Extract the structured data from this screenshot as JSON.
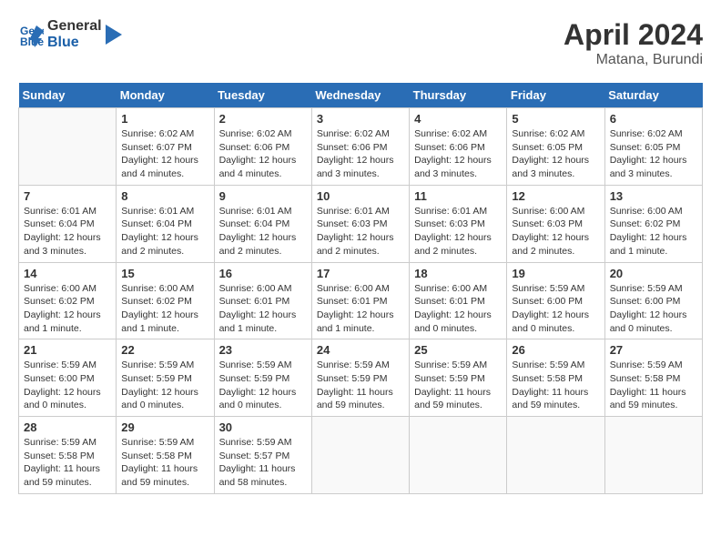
{
  "header": {
    "logo_line1": "General",
    "logo_line2": "Blue",
    "month_year": "April 2024",
    "location": "Matana, Burundi"
  },
  "weekdays": [
    "Sunday",
    "Monday",
    "Tuesday",
    "Wednesday",
    "Thursday",
    "Friday",
    "Saturday"
  ],
  "weeks": [
    [
      {
        "day": "",
        "sunrise": "",
        "sunset": "",
        "daylight": ""
      },
      {
        "day": "1",
        "sunrise": "6:02 AM",
        "sunset": "6:07 PM",
        "daylight": "12 hours and 4 minutes."
      },
      {
        "day": "2",
        "sunrise": "6:02 AM",
        "sunset": "6:06 PM",
        "daylight": "12 hours and 4 minutes."
      },
      {
        "day": "3",
        "sunrise": "6:02 AM",
        "sunset": "6:06 PM",
        "daylight": "12 hours and 3 minutes."
      },
      {
        "day": "4",
        "sunrise": "6:02 AM",
        "sunset": "6:06 PM",
        "daylight": "12 hours and 3 minutes."
      },
      {
        "day": "5",
        "sunrise": "6:02 AM",
        "sunset": "6:05 PM",
        "daylight": "12 hours and 3 minutes."
      },
      {
        "day": "6",
        "sunrise": "6:02 AM",
        "sunset": "6:05 PM",
        "daylight": "12 hours and 3 minutes."
      }
    ],
    [
      {
        "day": "7",
        "sunrise": "6:01 AM",
        "sunset": "6:04 PM",
        "daylight": "12 hours and 3 minutes."
      },
      {
        "day": "8",
        "sunrise": "6:01 AM",
        "sunset": "6:04 PM",
        "daylight": "12 hours and 2 minutes."
      },
      {
        "day": "9",
        "sunrise": "6:01 AM",
        "sunset": "6:04 PM",
        "daylight": "12 hours and 2 minutes."
      },
      {
        "day": "10",
        "sunrise": "6:01 AM",
        "sunset": "6:03 PM",
        "daylight": "12 hours and 2 minutes."
      },
      {
        "day": "11",
        "sunrise": "6:01 AM",
        "sunset": "6:03 PM",
        "daylight": "12 hours and 2 minutes."
      },
      {
        "day": "12",
        "sunrise": "6:00 AM",
        "sunset": "6:03 PM",
        "daylight": "12 hours and 2 minutes."
      },
      {
        "day": "13",
        "sunrise": "6:00 AM",
        "sunset": "6:02 PM",
        "daylight": "12 hours and 1 minute."
      }
    ],
    [
      {
        "day": "14",
        "sunrise": "6:00 AM",
        "sunset": "6:02 PM",
        "daylight": "12 hours and 1 minute."
      },
      {
        "day": "15",
        "sunrise": "6:00 AM",
        "sunset": "6:02 PM",
        "daylight": "12 hours and 1 minute."
      },
      {
        "day": "16",
        "sunrise": "6:00 AM",
        "sunset": "6:01 PM",
        "daylight": "12 hours and 1 minute."
      },
      {
        "day": "17",
        "sunrise": "6:00 AM",
        "sunset": "6:01 PM",
        "daylight": "12 hours and 1 minute."
      },
      {
        "day": "18",
        "sunrise": "6:00 AM",
        "sunset": "6:01 PM",
        "daylight": "12 hours and 0 minutes."
      },
      {
        "day": "19",
        "sunrise": "5:59 AM",
        "sunset": "6:00 PM",
        "daylight": "12 hours and 0 minutes."
      },
      {
        "day": "20",
        "sunrise": "5:59 AM",
        "sunset": "6:00 PM",
        "daylight": "12 hours and 0 minutes."
      }
    ],
    [
      {
        "day": "21",
        "sunrise": "5:59 AM",
        "sunset": "6:00 PM",
        "daylight": "12 hours and 0 minutes."
      },
      {
        "day": "22",
        "sunrise": "5:59 AM",
        "sunset": "5:59 PM",
        "daylight": "12 hours and 0 minutes."
      },
      {
        "day": "23",
        "sunrise": "5:59 AM",
        "sunset": "5:59 PM",
        "daylight": "12 hours and 0 minutes."
      },
      {
        "day": "24",
        "sunrise": "5:59 AM",
        "sunset": "5:59 PM",
        "daylight": "11 hours and 59 minutes."
      },
      {
        "day": "25",
        "sunrise": "5:59 AM",
        "sunset": "5:59 PM",
        "daylight": "11 hours and 59 minutes."
      },
      {
        "day": "26",
        "sunrise": "5:59 AM",
        "sunset": "5:58 PM",
        "daylight": "11 hours and 59 minutes."
      },
      {
        "day": "27",
        "sunrise": "5:59 AM",
        "sunset": "5:58 PM",
        "daylight": "11 hours and 59 minutes."
      }
    ],
    [
      {
        "day": "28",
        "sunrise": "5:59 AM",
        "sunset": "5:58 PM",
        "daylight": "11 hours and 59 minutes."
      },
      {
        "day": "29",
        "sunrise": "5:59 AM",
        "sunset": "5:58 PM",
        "daylight": "11 hours and 59 minutes."
      },
      {
        "day": "30",
        "sunrise": "5:59 AM",
        "sunset": "5:57 PM",
        "daylight": "11 hours and 58 minutes."
      },
      {
        "day": "",
        "sunrise": "",
        "sunset": "",
        "daylight": ""
      },
      {
        "day": "",
        "sunrise": "",
        "sunset": "",
        "daylight": ""
      },
      {
        "day": "",
        "sunrise": "",
        "sunset": "",
        "daylight": ""
      },
      {
        "day": "",
        "sunrise": "",
        "sunset": "",
        "daylight": ""
      }
    ]
  ]
}
